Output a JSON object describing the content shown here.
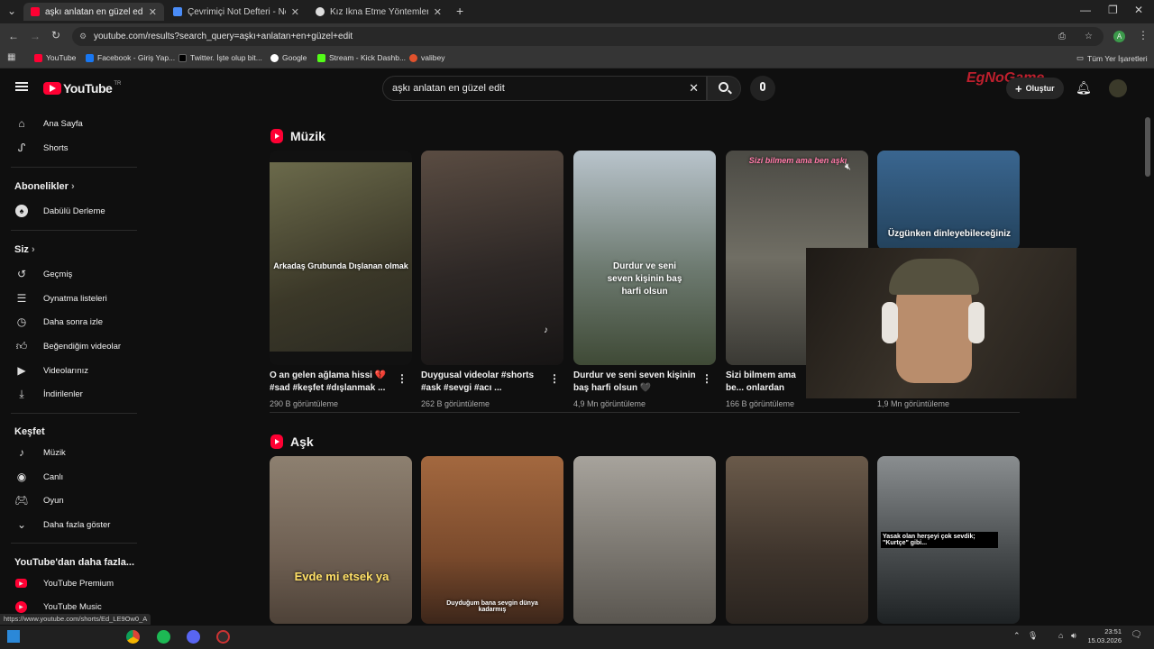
{
  "browser": {
    "tabs": [
      {
        "title": "aşkı anlatan en güzel edit - You",
        "color": "#ff0033"
      },
      {
        "title": "Çevrimiçi Not Defteri - Notlarını",
        "color": "#4a8cf7"
      },
      {
        "title": "Kız İkna Etme Yöntemleri",
        "color": "#dddddd"
      }
    ],
    "url": "youtube.com/results?search_query=aşkı+anlatan+en+güzel+edit",
    "bookmarks": [
      "YouTube",
      "Facebook - Giriş Yap...",
      "Twitter. İşte olup bit...",
      "Google",
      "Stream - Kick Dashb...",
      "valibey"
    ],
    "all_bookmarks": "Tüm Yer İşaretleri",
    "profile_initial": "A"
  },
  "header": {
    "logo": "YouTube",
    "logo_sup": "TR",
    "search_value": "aşkı anlatan en güzel edit",
    "create_label": "Oluştur",
    "watermark": "EgNoGame"
  },
  "sidebar": {
    "main": [
      {
        "label": "Ana Sayfa",
        "icon": "home-icon"
      },
      {
        "label": "Shorts",
        "icon": "shorts-icon"
      }
    ],
    "subs_heading": "Abonelikler",
    "subs": [
      {
        "label": "Dabülü Derleme",
        "icon": "channel-avatar-icon"
      }
    ],
    "you_heading": "Siz",
    "you": [
      {
        "label": "Geçmiş",
        "icon": "history-icon"
      },
      {
        "label": "Oynatma listeleri",
        "icon": "playlist-icon"
      },
      {
        "label": "Daha sonra izle",
        "icon": "clock-icon"
      },
      {
        "label": "Beğendiğim videolar",
        "icon": "thumbs-up-icon"
      },
      {
        "label": "Videolarınız",
        "icon": "video-icon"
      },
      {
        "label": "İndirilenler",
        "icon": "download-icon"
      }
    ],
    "explore_heading": "Keşfet",
    "explore": [
      {
        "label": "Müzik",
        "icon": "music-icon"
      },
      {
        "label": "Canlı",
        "icon": "live-icon"
      },
      {
        "label": "Oyun",
        "icon": "gaming-icon"
      },
      {
        "label": "Daha fazla göster",
        "icon": "chevron-down-icon"
      }
    ],
    "more_heading": "YouTube'dan daha fazla...",
    "more": [
      {
        "label": "YouTube Premium",
        "icon": "youtube-premium-icon"
      },
      {
        "label": "YouTube Music",
        "icon": "youtube-music-icon"
      }
    ]
  },
  "sections": [
    {
      "title": "Müzik",
      "videos": [
        {
          "title": "O an gelen ağlama hissi 💔 #sad #keşfet #dışlanmak ...",
          "views": "290 B görüntüleme",
          "overlay": "Arkadaş Grubunda Dışlanan olmak",
          "bg": "#5b5a40"
        },
        {
          "title": "Duygusal videolar #shorts #ask #sevgi #acı ...",
          "views": "262 B görüntüleme",
          "overlay": "",
          "bg": "#3a3634"
        },
        {
          "title": "Durdur ve seni seven kişinin baş harfi olsun 🖤",
          "views": "4,9 Mn görüntüleme",
          "overlay": "Durdur ve seni seven kişinin baş harfi olsun",
          "bg": "#6f7872"
        },
        {
          "title": "Sizi bilmem ama be... onlardan öğrendim",
          "views": "166 B görüntüleme",
          "overlay": "Sizi bilmem ama ben aşkı",
          "bg": "#59574f"
        },
        {
          "title": "",
          "views": "1,9 Mn görüntüleme",
          "overlay": "Üzgünken dinleyebileceğiniz",
          "bg": "#2c4a66"
        }
      ]
    },
    {
      "title": "Aşk",
      "videos": [
        {
          "overlay": "Evde mi etsek ya",
          "bg": "#7d6f62"
        },
        {
          "overlay": "Duyduğum bana sevgin dünya kadarmış",
          "bg": "#8a5a3c"
        },
        {
          "overlay": "",
          "bg": "#8d8a85"
        },
        {
          "overlay": "",
          "bg": "#4a4038"
        },
        {
          "overlay": "Yasak olan herşeyi çok sevdik; \"Kurtçe\" gibi...",
          "bg": "#505456"
        }
      ]
    }
  ],
  "status_url": "https://www.youtube.com/shorts/Ed_LE9Ow0_A",
  "taskbar": {
    "time": "23:51",
    "date": "15.03.2026"
  }
}
